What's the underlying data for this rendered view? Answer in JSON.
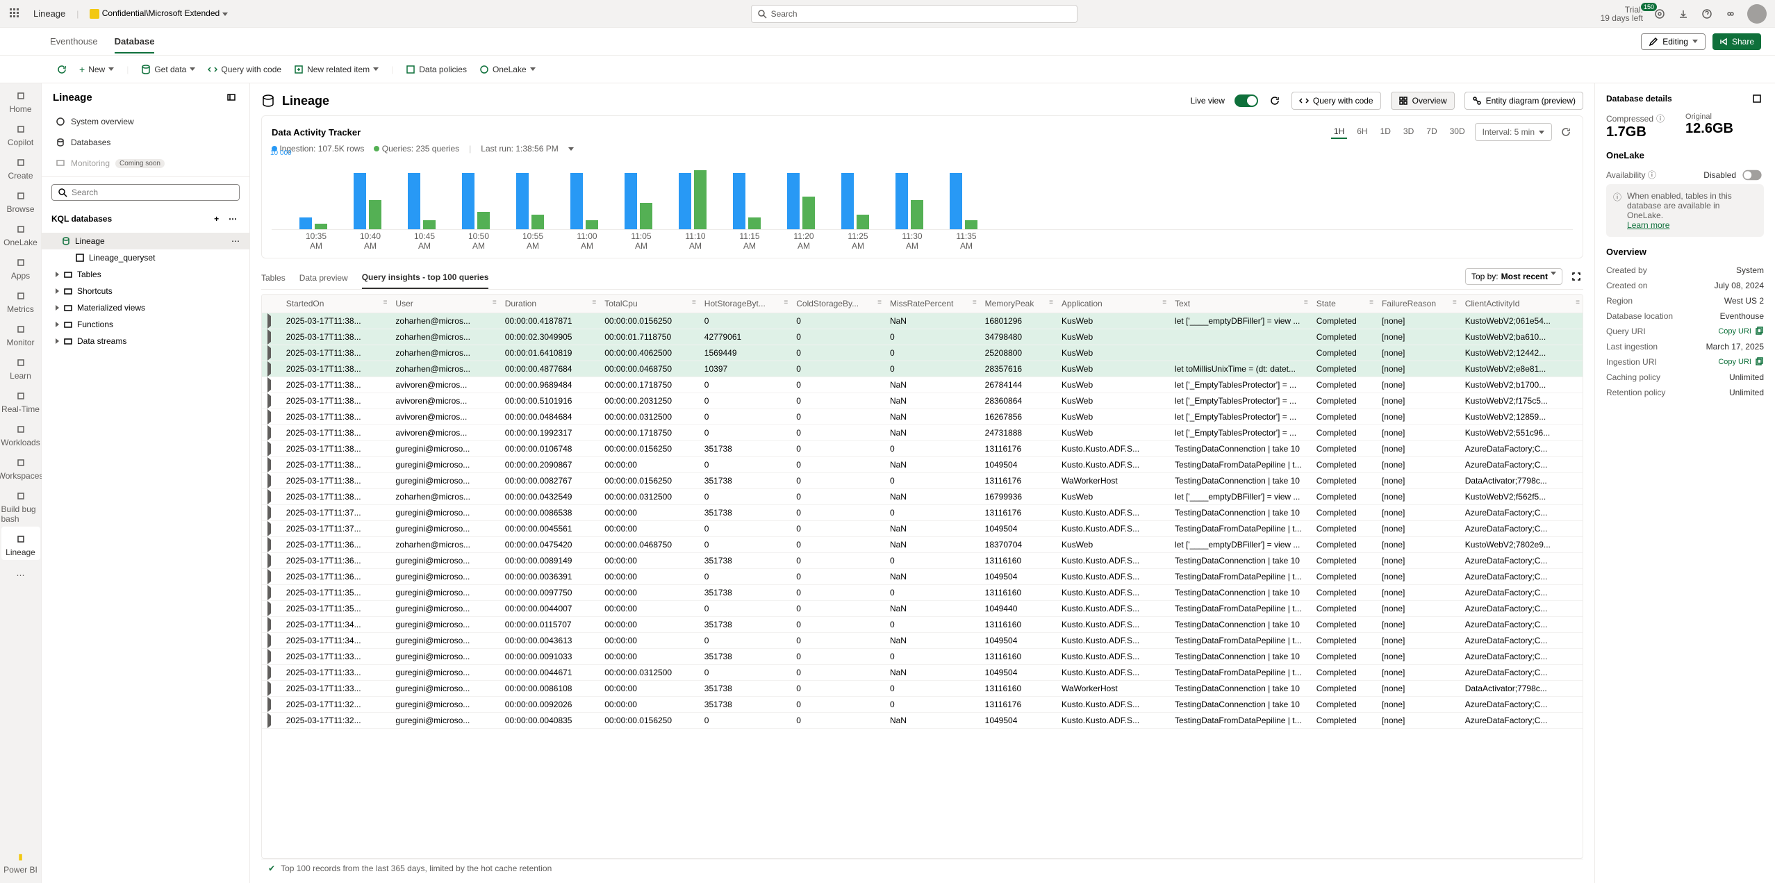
{
  "topbar": {
    "db_name": "Lineage",
    "sensitivity": "Confidential\\Microsoft Extended",
    "search_placeholder": "Search",
    "trial_line1": "Trial:",
    "trial_line2": "19 days left",
    "trial_count": "150"
  },
  "tabs": {
    "eventhouse": "Eventhouse",
    "database": "Database",
    "editing": "Editing",
    "share": "Share"
  },
  "toolbar": {
    "new": "New",
    "getdata": "Get data",
    "qwc": "Query with code",
    "nri": "New related item",
    "policies": "Data policies",
    "onelake": "OneLake"
  },
  "leftrail": {
    "items": [
      {
        "name": "home",
        "label": "Home"
      },
      {
        "name": "copilot",
        "label": "Copilot"
      },
      {
        "name": "create",
        "label": "Create"
      },
      {
        "name": "browse",
        "label": "Browse"
      },
      {
        "name": "onelake",
        "label": "OneLake"
      },
      {
        "name": "apps",
        "label": "Apps"
      },
      {
        "name": "metrics",
        "label": "Metrics"
      },
      {
        "name": "monitor",
        "label": "Monitor"
      },
      {
        "name": "learn",
        "label": "Learn"
      },
      {
        "name": "realtime",
        "label": "Real-Time"
      },
      {
        "name": "workloads",
        "label": "Workloads"
      },
      {
        "name": "workspaces",
        "label": "Workspaces"
      },
      {
        "name": "buildbug",
        "label": "Build bug bash"
      },
      {
        "name": "lineage",
        "label": "Lineage"
      }
    ],
    "powerbi": "Power BI"
  },
  "sidepanel": {
    "title": "Lineage",
    "system_overview": "System overview",
    "databases": "Databases",
    "monitoring": "Monitoring",
    "coming_soon": "Coming soon",
    "search_placeholder": "Search",
    "section": "KQL databases",
    "selected_db": "Lineage",
    "queryset": "Lineage_queryset",
    "folders": [
      {
        "label": "Tables"
      },
      {
        "label": "Shortcuts"
      },
      {
        "label": "Materialized views"
      },
      {
        "label": "Functions"
      },
      {
        "label": "Data streams"
      }
    ]
  },
  "center": {
    "title": "Lineage",
    "live_view": "Live view",
    "qwc": "Query with code",
    "overview": "Overview",
    "entity": "Entity diagram (preview)"
  },
  "chart_data": {
    "type": "bar",
    "title": "Data Activity Tracker",
    "legend_ingestion": "Ingestion: 107.5K rows",
    "legend_queries": "Queries: 235 queries",
    "last_run": "Last run: 1:38:56 PM",
    "ranges": [
      "1H",
      "6H",
      "1D",
      "3D",
      "7D",
      "30D"
    ],
    "active_range": "1H",
    "interval_label": "Interval: 5 min",
    "ymax_label": "10 000",
    "categories": [
      "10:35 AM",
      "10:40 AM",
      "10:45 AM",
      "10:50 AM",
      "10:55 AM",
      "11:00 AM",
      "11:05 AM",
      "11:10 AM",
      "11:15 AM",
      "11:20 AM",
      "11:25 AM",
      "11:30 AM",
      "11:35 AM"
    ],
    "series": [
      {
        "name": "Ingestion",
        "color": "#2899f5",
        "values": [
          20,
          95,
          95,
          95,
          95,
          95,
          95,
          95,
          95,
          95,
          95,
          95,
          95
        ]
      },
      {
        "name": "Queries",
        "color": "#54b054",
        "values": [
          10,
          50,
          15,
          30,
          25,
          15,
          45,
          100,
          20,
          55,
          25,
          50,
          15
        ]
      }
    ]
  },
  "data_tabs": {
    "tables": "Tables",
    "preview": "Data preview",
    "qi": "Query insights - top 100 queries",
    "sort_prefix": "Top by: ",
    "sort_value": "Most recent"
  },
  "grid": {
    "headers": [
      "",
      "StartedOn",
      "User",
      "Duration",
      "TotalCpu",
      "HotStorageByt...",
      "ColdStorageBy...",
      "MissRatePercent",
      "MemoryPeak",
      "Application",
      "Text",
      "State",
      "FailureReason",
      "ClientActivityId"
    ],
    "footer": "Top 100 records from the last 365 days, limited by the hot cache retention",
    "rows": [
      {
        "hl": true,
        "t": "2025-03-17T11:38...",
        "u": "zoharhen@micros...",
        "d": "00:00:00.4187871",
        "cpu": "00:00:00.0156250",
        "hs": "0",
        "cs": "0",
        "mr": "NaN",
        "mp": "16801296",
        "app": "KusWeb",
        "txt": "let ['____emptyDBFiller'] = view ...",
        "st": "Completed",
        "fr": "[none]",
        "ca": "KustoWebV2;061e54..."
      },
      {
        "hl": true,
        "t": "2025-03-17T11:38...",
        "u": "zoharhen@micros...",
        "d": "00:00:02.3049905",
        "cpu": "00:00:01.7118750",
        "hs": "42779061",
        "cs": "0",
        "mr": "0",
        "mp": "34798480",
        "app": "KusWeb",
        "txt": "",
        "st": "Completed",
        "fr": "[none]",
        "ca": "KustoWebV2;ba610..."
      },
      {
        "hl": true,
        "t": "2025-03-17T11:38...",
        "u": "zoharhen@micros...",
        "d": "00:00:01.6410819",
        "cpu": "00:00:00.4062500",
        "hs": "1569449",
        "cs": "0",
        "mr": "0",
        "mp": "25208800",
        "app": "KusWeb",
        "txt": "",
        "st": "Completed",
        "fr": "[none]",
        "ca": "KustoWebV2;12442..."
      },
      {
        "hl": true,
        "t": "2025-03-17T11:38...",
        "u": "zoharhen@micros...",
        "d": "00:00:00.4877684",
        "cpu": "00:00:00.0468750",
        "hs": "10397",
        "cs": "0",
        "mr": "0",
        "mp": "28357616",
        "app": "KusWeb",
        "txt": "let toMillisUnixTime = (dt: datet...",
        "st": "Completed",
        "fr": "[none]",
        "ca": "KustoWebV2;e8e81..."
      },
      {
        "hl": false,
        "t": "2025-03-17T11:38...",
        "u": "avivoren@micros...",
        "d": "00:00:00.9689484",
        "cpu": "00:00:00.1718750",
        "hs": "0",
        "cs": "0",
        "mr": "NaN",
        "mp": "26784144",
        "app": "KusWeb",
        "txt": "let ['_EmptyTablesProtector'] = ...",
        "st": "Completed",
        "fr": "[none]",
        "ca": "KustoWebV2;b1700..."
      },
      {
        "hl": false,
        "t": "2025-03-17T11:38...",
        "u": "avivoren@micros...",
        "d": "00:00:00.5101916",
        "cpu": "00:00:00.2031250",
        "hs": "0",
        "cs": "0",
        "mr": "NaN",
        "mp": "28360864",
        "app": "KusWeb",
        "txt": "let ['_EmptyTablesProtector'] = ...",
        "st": "Completed",
        "fr": "[none]",
        "ca": "KustoWebV2;f175c5..."
      },
      {
        "hl": false,
        "t": "2025-03-17T11:38...",
        "u": "avivoren@micros...",
        "d": "00:00:00.0484684",
        "cpu": "00:00:00.0312500",
        "hs": "0",
        "cs": "0",
        "mr": "NaN",
        "mp": "16267856",
        "app": "KusWeb",
        "txt": "let ['_EmptyTablesProtector'] = ...",
        "st": "Completed",
        "fr": "[none]",
        "ca": "KustoWebV2;12859..."
      },
      {
        "hl": false,
        "t": "2025-03-17T11:38...",
        "u": "avivoren@micros...",
        "d": "00:00:00.1992317",
        "cpu": "00:00:00.1718750",
        "hs": "0",
        "cs": "0",
        "mr": "NaN",
        "mp": "24731888",
        "app": "KusWeb",
        "txt": "let ['_EmptyTablesProtector'] = ...",
        "st": "Completed",
        "fr": "[none]",
        "ca": "KustoWebV2;551c96..."
      },
      {
        "hl": false,
        "t": "2025-03-17T11:38...",
        "u": "guregini@microso...",
        "d": "00:00:00.0106748",
        "cpu": "00:00:00.0156250",
        "hs": "351738",
        "cs": "0",
        "mr": "0",
        "mp": "13116176",
        "app": "Kusto.Kusto.ADF.S...",
        "txt": "TestingDataConnenction | take 10",
        "st": "Completed",
        "fr": "[none]",
        "ca": "AzureDataFactory;C..."
      },
      {
        "hl": false,
        "t": "2025-03-17T11:38...",
        "u": "guregini@microso...",
        "d": "00:00:00.2090867",
        "cpu": "00:00:00",
        "hs": "0",
        "cs": "0",
        "mr": "NaN",
        "mp": "1049504",
        "app": "Kusto.Kusto.ADF.S...",
        "txt": "TestingDataFromDataPepiline | t...",
        "st": "Completed",
        "fr": "[none]",
        "ca": "AzureDataFactory;C..."
      },
      {
        "hl": false,
        "t": "2025-03-17T11:38...",
        "u": "guregini@microso...",
        "d": "00:00:00.0082767",
        "cpu": "00:00:00.0156250",
        "hs": "351738",
        "cs": "0",
        "mr": "0",
        "mp": "13116176",
        "app": "WaWorkerHost",
        "txt": "TestingDataConnenction | take 10",
        "st": "Completed",
        "fr": "[none]",
        "ca": "DataActivator;7798c..."
      },
      {
        "hl": false,
        "t": "2025-03-17T11:38...",
        "u": "zoharhen@micros...",
        "d": "00:00:00.0432549",
        "cpu": "00:00:00.0312500",
        "hs": "0",
        "cs": "0",
        "mr": "NaN",
        "mp": "16799936",
        "app": "KusWeb",
        "txt": "let ['____emptyDBFiller'] = view ...",
        "st": "Completed",
        "fr": "[none]",
        "ca": "KustoWebV2;f562f5..."
      },
      {
        "hl": false,
        "t": "2025-03-17T11:37...",
        "u": "guregini@microso...",
        "d": "00:00:00.0086538",
        "cpu": "00:00:00",
        "hs": "351738",
        "cs": "0",
        "mr": "0",
        "mp": "13116176",
        "app": "Kusto.Kusto.ADF.S...",
        "txt": "TestingDataConnenction | take 10",
        "st": "Completed",
        "fr": "[none]",
        "ca": "AzureDataFactory;C..."
      },
      {
        "hl": false,
        "t": "2025-03-17T11:37...",
        "u": "guregini@microso...",
        "d": "00:00:00.0045561",
        "cpu": "00:00:00",
        "hs": "0",
        "cs": "0",
        "mr": "NaN",
        "mp": "1049504",
        "app": "Kusto.Kusto.ADF.S...",
        "txt": "TestingDataFromDataPepiline | t...",
        "st": "Completed",
        "fr": "[none]",
        "ca": "AzureDataFactory;C..."
      },
      {
        "hl": false,
        "t": "2025-03-17T11:36...",
        "u": "zoharhen@micros...",
        "d": "00:00:00.0475420",
        "cpu": "00:00:00.0468750",
        "hs": "0",
        "cs": "0",
        "mr": "NaN",
        "mp": "18370704",
        "app": "KusWeb",
        "txt": "let ['____emptyDBFiller'] = view ...",
        "st": "Completed",
        "fr": "[none]",
        "ca": "KustoWebV2;7802e9..."
      },
      {
        "hl": false,
        "t": "2025-03-17T11:36...",
        "u": "guregini@microso...",
        "d": "00:00:00.0089149",
        "cpu": "00:00:00",
        "hs": "351738",
        "cs": "0",
        "mr": "0",
        "mp": "13116160",
        "app": "Kusto.Kusto.ADF.S...",
        "txt": "TestingDataConnenction | take 10",
        "st": "Completed",
        "fr": "[none]",
        "ca": "AzureDataFactory;C..."
      },
      {
        "hl": false,
        "t": "2025-03-17T11:36...",
        "u": "guregini@microso...",
        "d": "00:00:00.0036391",
        "cpu": "00:00:00",
        "hs": "0",
        "cs": "0",
        "mr": "NaN",
        "mp": "1049504",
        "app": "Kusto.Kusto.ADF.S...",
        "txt": "TestingDataFromDataPepiline | t...",
        "st": "Completed",
        "fr": "[none]",
        "ca": "AzureDataFactory;C..."
      },
      {
        "hl": false,
        "t": "2025-03-17T11:35...",
        "u": "guregini@microso...",
        "d": "00:00:00.0097750",
        "cpu": "00:00:00",
        "hs": "351738",
        "cs": "0",
        "mr": "0",
        "mp": "13116160",
        "app": "Kusto.Kusto.ADF.S...",
        "txt": "TestingDataConnenction | take 10",
        "st": "Completed",
        "fr": "[none]",
        "ca": "AzureDataFactory;C..."
      },
      {
        "hl": false,
        "t": "2025-03-17T11:35...",
        "u": "guregini@microso...",
        "d": "00:00:00.0044007",
        "cpu": "00:00:00",
        "hs": "0",
        "cs": "0",
        "mr": "NaN",
        "mp": "1049440",
        "app": "Kusto.Kusto.ADF.S...",
        "txt": "TestingDataFromDataPepiline | t...",
        "st": "Completed",
        "fr": "[none]",
        "ca": "AzureDataFactory;C..."
      },
      {
        "hl": false,
        "t": "2025-03-17T11:34...",
        "u": "guregini@microso...",
        "d": "00:00:00.0115707",
        "cpu": "00:00:00",
        "hs": "351738",
        "cs": "0",
        "mr": "0",
        "mp": "13116160",
        "app": "Kusto.Kusto.ADF.S...",
        "txt": "TestingDataConnenction | take 10",
        "st": "Completed",
        "fr": "[none]",
        "ca": "AzureDataFactory;C..."
      },
      {
        "hl": false,
        "t": "2025-03-17T11:34...",
        "u": "guregini@microso...",
        "d": "00:00:00.0043613",
        "cpu": "00:00:00",
        "hs": "0",
        "cs": "0",
        "mr": "NaN",
        "mp": "1049504",
        "app": "Kusto.Kusto.ADF.S...",
        "txt": "TestingDataFromDataPepiline | t...",
        "st": "Completed",
        "fr": "[none]",
        "ca": "AzureDataFactory;C..."
      },
      {
        "hl": false,
        "t": "2025-03-17T11:33...",
        "u": "guregini@microso...",
        "d": "00:00:00.0091033",
        "cpu": "00:00:00",
        "hs": "351738",
        "cs": "0",
        "mr": "0",
        "mp": "13116160",
        "app": "Kusto.Kusto.ADF.S...",
        "txt": "TestingDataConnenction | take 10",
        "st": "Completed",
        "fr": "[none]",
        "ca": "AzureDataFactory;C..."
      },
      {
        "hl": false,
        "t": "2025-03-17T11:33...",
        "u": "guregini@microso...",
        "d": "00:00:00.0044671",
        "cpu": "00:00:00.0312500",
        "hs": "0",
        "cs": "0",
        "mr": "NaN",
        "mp": "1049504",
        "app": "Kusto.Kusto.ADF.S...",
        "txt": "TestingDataFromDataPepiline | t...",
        "st": "Completed",
        "fr": "[none]",
        "ca": "AzureDataFactory;C..."
      },
      {
        "hl": false,
        "t": "2025-03-17T11:33...",
        "u": "guregini@microso...",
        "d": "00:00:00.0086108",
        "cpu": "00:00:00",
        "hs": "351738",
        "cs": "0",
        "mr": "0",
        "mp": "13116160",
        "app": "WaWorkerHost",
        "txt": "TestingDataConnenction | take 10",
        "st": "Completed",
        "fr": "[none]",
        "ca": "DataActivator;7798c..."
      },
      {
        "hl": false,
        "t": "2025-03-17T11:32...",
        "u": "guregini@microso...",
        "d": "00:00:00.0092026",
        "cpu": "00:00:00",
        "hs": "351738",
        "cs": "0",
        "mr": "0",
        "mp": "13116176",
        "app": "Kusto.Kusto.ADF.S...",
        "txt": "TestingDataConnenction | take 10",
        "st": "Completed",
        "fr": "[none]",
        "ca": "AzureDataFactory;C..."
      },
      {
        "hl": false,
        "t": "2025-03-17T11:32...",
        "u": "guregini@microso...",
        "d": "00:00:00.0040835",
        "cpu": "00:00:00.0156250",
        "hs": "0",
        "cs": "0",
        "mr": "NaN",
        "mp": "1049504",
        "app": "Kusto.Kusto.ADF.S...",
        "txt": "TestingDataFromDataPepiline | t...",
        "st": "Completed",
        "fr": "[none]",
        "ca": "AzureDataFactory;C..."
      }
    ]
  },
  "details": {
    "title": "Database details",
    "compressed_label": "Compressed",
    "compressed_value": "1.7GB",
    "original_label": "Original",
    "original_value": "12.6GB",
    "onelake_title": "OneLake",
    "availability": "Availability",
    "disabled": "Disabled",
    "info_text": "When enabled, tables in this database are available in OneLake.",
    "learn_more": "Learn more",
    "overview_title": "Overview",
    "rows": [
      {
        "k": "Created by",
        "v": "System"
      },
      {
        "k": "Created on",
        "v": "July 08, 2024"
      },
      {
        "k": "Region",
        "v": "West US 2"
      },
      {
        "k": "Database location",
        "v": "Eventhouse"
      },
      {
        "k": "Query URI",
        "v": "Copy URI",
        "copy": true
      },
      {
        "k": "Last ingestion",
        "v": "March 17, 2025"
      },
      {
        "k": "Ingestion URI",
        "v": "Copy URI",
        "copy": true
      },
      {
        "k": "Caching policy",
        "v": "Unlimited"
      },
      {
        "k": "Retention policy",
        "v": "Unlimited"
      }
    ]
  }
}
